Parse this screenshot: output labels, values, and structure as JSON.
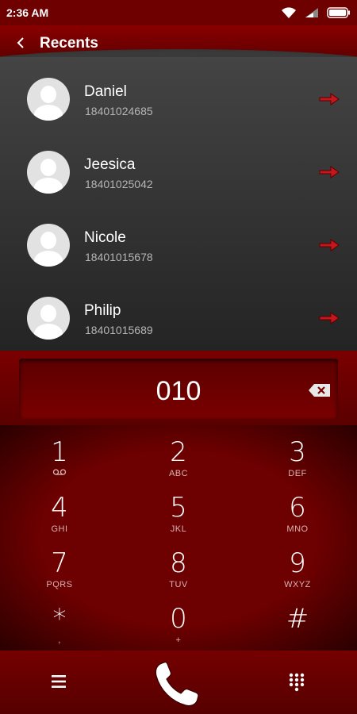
{
  "status_bar": {
    "time": "2:36 AM",
    "icons": [
      "wifi-icon",
      "signal-icon",
      "battery-icon"
    ]
  },
  "header": {
    "title": "Recents",
    "back_icon": "chevron-left-icon"
  },
  "recents": [
    {
      "name": "Daniel",
      "number": "18401024685"
    },
    {
      "name": "Jeesica",
      "number": "18401025042"
    },
    {
      "name": "Nicole",
      "number": "18401015678"
    },
    {
      "name": "Philip",
      "number": "18401015689"
    }
  ],
  "dial": {
    "number": "010",
    "backspace_icon": "backspace-icon"
  },
  "keypad": [
    {
      "digit": "1",
      "letters": ""
    },
    {
      "digit": "2",
      "letters": "ABC"
    },
    {
      "digit": "3",
      "letters": "DEF"
    },
    {
      "digit": "4",
      "letters": "GHI"
    },
    {
      "digit": "5",
      "letters": "JKL"
    },
    {
      "digit": "6",
      "letters": "MNO"
    },
    {
      "digit": "7",
      "letters": "PQRS"
    },
    {
      "digit": "8",
      "letters": "TUV"
    },
    {
      "digit": "9",
      "letters": "WXYZ"
    },
    {
      "digit": "*",
      "letters": ","
    },
    {
      "digit": "0",
      "letters": "+"
    },
    {
      "digit": "#",
      "letters": ""
    }
  ],
  "bottom_bar": {
    "menu_icon": "menu-icon",
    "call_icon": "phone-icon",
    "dialpad_icon": "dialpad-icon"
  },
  "colors": {
    "accent": "#8a0000",
    "arrow": "#c4161c"
  }
}
